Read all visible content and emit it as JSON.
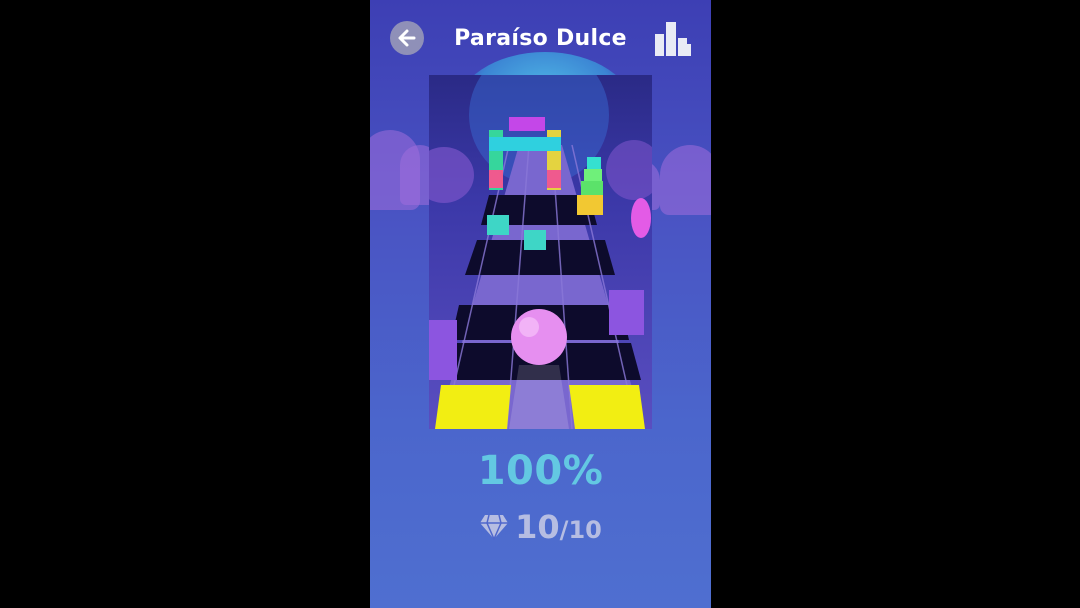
{
  "header": {
    "title": "Paraíso Dulce"
  },
  "result": {
    "percent": "100%",
    "gems_collected": "10",
    "gems_total": "/10"
  },
  "icons": {
    "back": "back-arrow-icon",
    "stats": "bar-chart-icon",
    "gem": "diamond-icon"
  },
  "colors": {
    "accent_percent": "#63c8e2",
    "ball": "#e68ff0",
    "highlight_tile": "#f2ee12"
  }
}
